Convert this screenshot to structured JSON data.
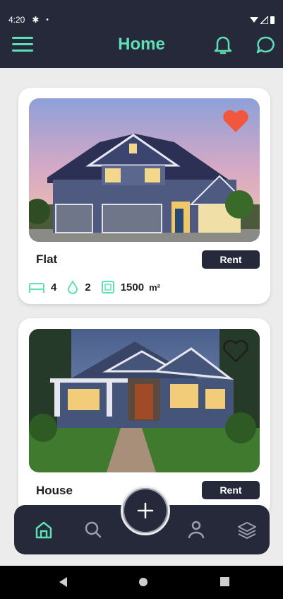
{
  "status_bar": {
    "time": "4:20"
  },
  "header": {
    "title": "Home"
  },
  "listings": [
    {
      "title": "Flat",
      "action": "Rent",
      "favorite": true,
      "beds": "4",
      "baths": "2",
      "area": "1500",
      "area_unit": "m²"
    },
    {
      "title": "House",
      "action": "Rent",
      "favorite": false
    }
  ],
  "nav": {
    "items": [
      "home-icon",
      "search-icon",
      "add-icon",
      "profile-icon",
      "layers-icon"
    ],
    "active": "home-icon"
  },
  "colors": {
    "accent": "#5ee0b6",
    "dark": "#26293a",
    "favorite": "#f0573c",
    "background": "#ececec"
  }
}
